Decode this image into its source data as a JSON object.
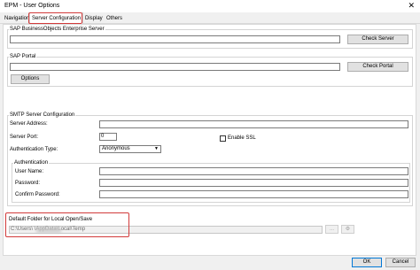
{
  "window": {
    "title": "EPM - User Options",
    "close_glyph": "✕"
  },
  "tabs": [
    {
      "label": "Navigation"
    },
    {
      "label": "Server Configuration"
    },
    {
      "label": "Display"
    },
    {
      "label": "Others"
    }
  ],
  "sap_bo": {
    "group_label": "SAP BusinessObjects Enterprise Server",
    "value": "",
    "check_label": "Check Server"
  },
  "sap_portal": {
    "group_label": "SAP Portal",
    "value": "",
    "check_label": "Check Portal",
    "options_label": "Options"
  },
  "smtp": {
    "group_label": "SMTP Server Configuration",
    "server_address_label": "Server Address:",
    "server_address_value": "",
    "server_port_label": "Server Port:",
    "server_port_value": "0",
    "enable_ssl_label": "Enable SSL",
    "auth_type_label": "Authentication Type:",
    "auth_type_value": "Anonymous",
    "authentication": {
      "group_label": "Authentication",
      "user_name_label": "User Name:",
      "user_name_value": "",
      "password_label": "Password:",
      "password_value": "",
      "confirm_password_label": "Confirm Password:",
      "confirm_password_value": ""
    }
  },
  "local_folder": {
    "label": "Default Folder for Local Open/Save",
    "path": "C:\\Users\\            \\AppData\\Local\\Temp",
    "browse_label": "...",
    "reset_glyph": "⚙"
  },
  "footer": {
    "ok_label": "OK",
    "cancel_label": "Cancel"
  },
  "colors": {
    "highlight": "#d23b3b",
    "primary_border": "#0078d7"
  }
}
